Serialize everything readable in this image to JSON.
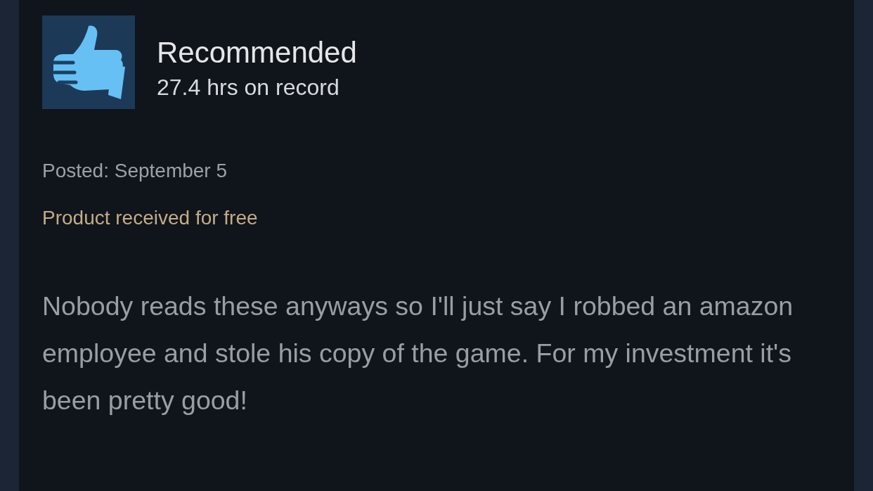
{
  "review": {
    "verdict": "Recommended",
    "recommended": true,
    "hours": "27.4 hrs on record",
    "posted": "Posted: September 5",
    "received_free": "Product received for free",
    "body": "Nobody reads these anyways so I'll just say I robbed an amazon employee and stole his copy of the game. For my investment it's been pretty good!"
  }
}
